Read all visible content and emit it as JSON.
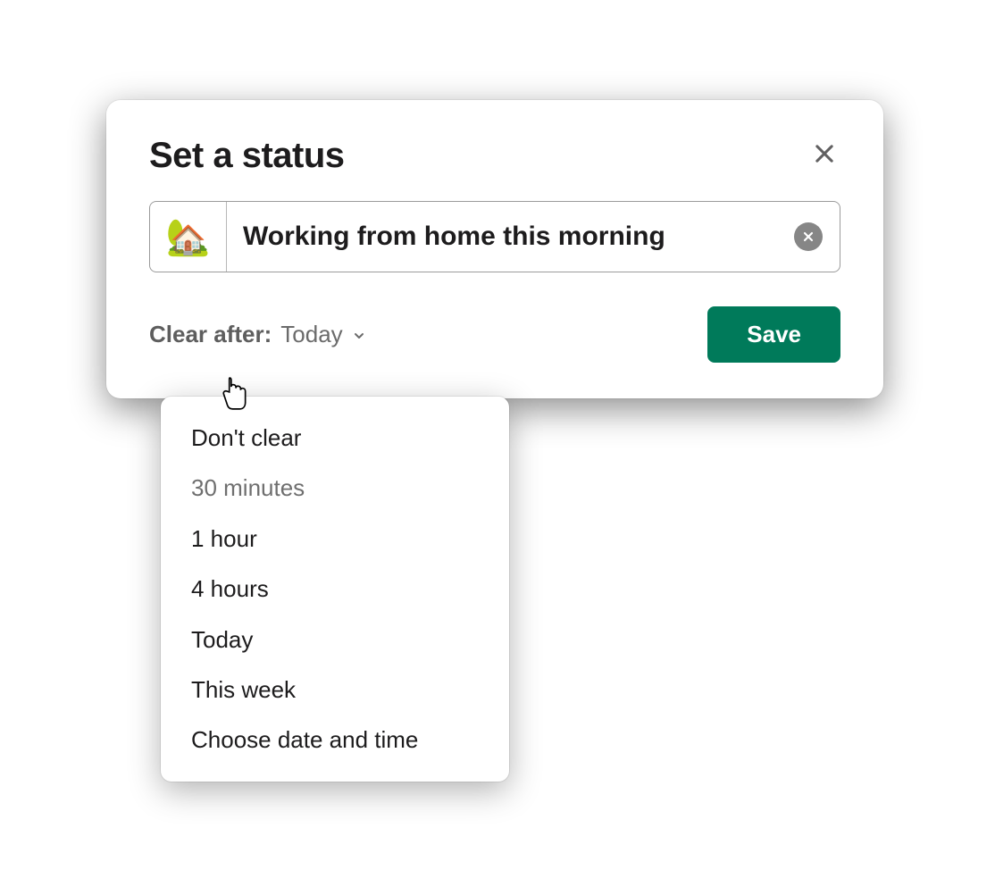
{
  "modal": {
    "title": "Set a status",
    "emoji": "🏡",
    "status_text": "Working from home this morning",
    "clear_after_label": "Clear after:",
    "clear_after_value": "Today",
    "save_label": "Save"
  },
  "dropdown": {
    "items": [
      {
        "label": "Don't clear",
        "muted": false
      },
      {
        "label": "30 minutes",
        "muted": true
      },
      {
        "label": "1 hour",
        "muted": false
      },
      {
        "label": "4 hours",
        "muted": false
      },
      {
        "label": "Today",
        "muted": false
      },
      {
        "label": "This week",
        "muted": false
      },
      {
        "label": "Choose date and time",
        "muted": false
      }
    ]
  }
}
